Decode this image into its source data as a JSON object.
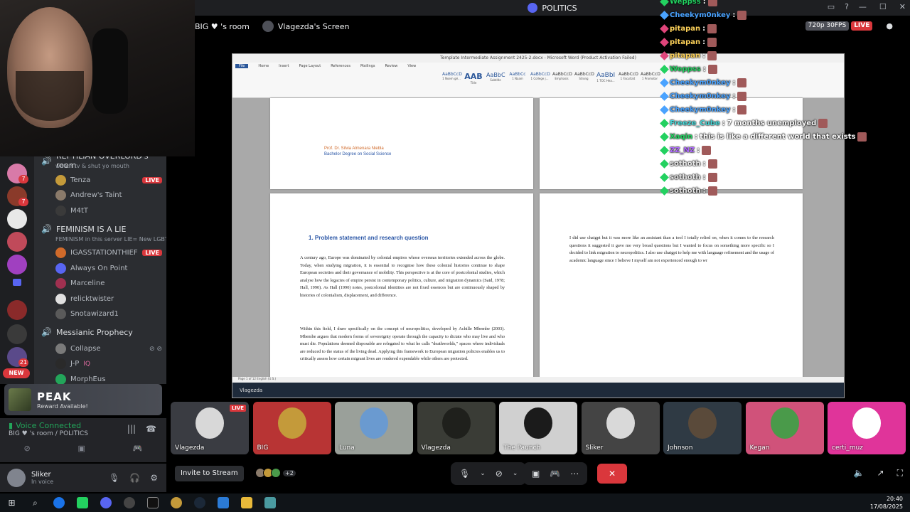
{
  "window": {
    "title": "POLITICS"
  },
  "stream_header": {
    "room": "BIG ♥ 's room",
    "screen_label": "Vlagezda's Screen",
    "quality": "720p 30FPS",
    "live": "LIVE"
  },
  "channels": [
    {
      "name": "REPTILIAN OVERLORD's room",
      "sub": "watch tv & shut yo mouth"
    },
    {
      "name": "FEMINISM IS A LIE",
      "sub": "FEMINISM in this server LIE= New LGBT..."
    },
    {
      "name": "Messianic Prophecy",
      "sub": ""
    }
  ],
  "channel_users": [
    {
      "name": "Tenza",
      "live": "LIVE",
      "color": "#c49a3a"
    },
    {
      "name": "Andrew's Taint",
      "live": "",
      "color": "#8a7a6a"
    },
    {
      "name": "M4tT",
      "live": "",
      "color": "#3a3a3a"
    },
    {
      "name": "IGASSTATIONTHIEF",
      "live": "LIVE",
      "color": "#d06a2a"
    },
    {
      "name": "Always On Point",
      "live": "",
      "color": "#5865f2"
    },
    {
      "name": "Marceline",
      "live": "",
      "color": "#a03050"
    },
    {
      "name": "relicktwister",
      "live": "",
      "color": "#e0e0e0"
    },
    {
      "name": "Snotawizard1",
      "live": "",
      "color": "#5a5a5a"
    },
    {
      "name": "Collapse",
      "live": "",
      "color": "#7a7a7a"
    },
    {
      "name": "J-P",
      "live": "",
      "extra": "IQ",
      "color": "#2a2a2a"
    },
    {
      "name": "MorphEus",
      "live": "",
      "color": "#23a55a"
    }
  ],
  "rail": {
    "mentions": [
      "7",
      "7",
      "21"
    ],
    "new_label": "NEW"
  },
  "activity": {
    "title": "PEAK",
    "subtitle": "Reward Available!"
  },
  "voice": {
    "status": "Voice Connected",
    "location": "BIG ♥ 's room / POLITICS"
  },
  "user": {
    "name": "Sliker",
    "status": "In voice"
  },
  "word": {
    "title": "Template Intermediate Assignment 2425-2.docx - Microsoft Word (Product Activation Failed)",
    "tabs": [
      "File",
      "Home",
      "Insert",
      "Page Layout",
      "References",
      "Mailings",
      "Review",
      "View"
    ],
    "style_previews": [
      "AaBbCcD",
      "AAB",
      "AaBbC",
      "AaBbCc",
      "AaBbCcD",
      "AaBbCcD",
      "AaBbCcD",
      "AaBbI",
      "AaBbCcD",
      "AaBbCcD"
    ],
    "style_labels": [
      "1 Noem gé...",
      "Title",
      "Subtitle",
      "1 Naam",
      "1 College j...",
      "Emphasis",
      "Strong",
      "1 TOC Hea...",
      "1 Facultait",
      "1 Promotor"
    ],
    "status": "Page 1 of 12    English (U.S.)",
    "taskbar_label": "Vlagezda",
    "author": "Prof. Dr. Silvia Almenara Niebla",
    "degree": "Bachelor Degree on Social Science",
    "heading": "1.   Problem statement and research question",
    "para1": "A century ago, Europe was dominated by colonial empires whose overseas territories extended across the globe. Today, when studying migration, it is essential to recognise how these colonial histories continue to shape European societies and their governance of mobility. This perspective is at the core of postcolonial studies, which analyse how the legacies of empire persist in contemporary politics, culture, and migration dynamics (Said, 1978; Hall, 1990). As Hall (1990) notes, postcolonial identities are not fixed essences but are continuously shaped by histories of colonialism, displacement, and difference.",
    "para2": "Within this field, I draw specifically on the concept of necropolitics, developed by Achille Mbembe (2003). Mbembe argues that modern forms of sovereignty operate through the capacity to dictate who may live and who must die. Populations deemed disposable are relegated to what he calls \"deathworlds,\" spaces where individuals are reduced to the status of the living dead. Applying this framework to European migration policies enables us to critically assess how certain migrant lives are rendered expendable while others are protected.",
    "para3": "I did use chatgpt but it was more like an assistant than a tool I totally relied on, when it comes to the research questions it suggested it gave me very broad questions but I wanted to focus on something more specific so I decided to link migration to necropolitics. I also use chatgpt to help me with language refinement and the usage of academic language since I believe I myself am not experienced enough to wr"
  },
  "chat": [
    {
      "name": "Weppss",
      "text": "",
      "color": "#23d160",
      "icon": "#23d160"
    },
    {
      "name": "Cheekym0nkey",
      "text": "",
      "color": "#4aa3ff",
      "icon": "#4aa3ff"
    },
    {
      "name": "pitapan",
      "text": "",
      "color": "#ffd35a",
      "icon": "#e0457b"
    },
    {
      "name": "pitapan",
      "text": "",
      "color": "#ffd35a",
      "icon": "#e0457b"
    },
    {
      "name": "pitapan",
      "text": "",
      "color": "#ffd35a",
      "icon": "#e0457b"
    },
    {
      "name": "Weppss",
      "text": "",
      "color": "#23d160",
      "icon": "#23d160"
    },
    {
      "name": "Cheekym0nkey",
      "text": "",
      "color": "#4aa3ff",
      "icon": "#4aa3ff"
    },
    {
      "name": "Cheekym0nkey",
      "text": "",
      "color": "#4aa3ff",
      "icon": "#4aa3ff"
    },
    {
      "name": "Cheekym0nkey",
      "text": "",
      "color": "#4aa3ff",
      "icon": "#4aa3ff"
    },
    {
      "name": "Freeze_Cube",
      "text": "7 months unemployed",
      "color": "#4ad9d9",
      "icon": "#23d160"
    },
    {
      "name": "Xaqin",
      "text": "this is like a different world that exists",
      "color": "#23d160",
      "icon": "#23d160"
    },
    {
      "name": "ZZ_NZ",
      "text": "",
      "color": "#b06aff",
      "icon": "#23d160"
    },
    {
      "name": "sothoth",
      "text": "",
      "color": "#e8e8e8",
      "icon": "#23d160"
    },
    {
      "name": "sothoth",
      "text": "",
      "color": "#e8e8e8",
      "icon": "#23d160"
    },
    {
      "name": "sothoth",
      "text": "",
      "color": "#e8e8e8",
      "icon": "#23d160"
    }
  ],
  "tiles": [
    {
      "name": "Vlagezda",
      "bg": "#3a3c42",
      "live": "LIVE",
      "art": "#d8d8d8"
    },
    {
      "name": "BIG",
      "bg": "#b83434",
      "live": "",
      "art": "#c49a3a"
    },
    {
      "name": "Luna",
      "bg": "#9aa09a",
      "live": "",
      "art": "#6a9ad0"
    },
    {
      "name": "Vlagezda",
      "bg": "#3a3c36",
      "live": "",
      "art": "#1f201c"
    },
    {
      "name": "The Paunch",
      "bg": "#d0d0d0",
      "live": "",
      "art": "#1b1b1b"
    },
    {
      "name": "Sliker",
      "bg": "#444",
      "live": "",
      "art": "#d9d9d9"
    },
    {
      "name": "Johnson",
      "bg": "#2f3a44",
      "live": "",
      "art": "#5a4a3a"
    },
    {
      "name": "Kegan",
      "bg": "#d0527a",
      "live": "",
      "art": "#4a9a4a"
    },
    {
      "name": "certi_muz",
      "bg": "#e0349a",
      "live": "",
      "art": "#ffffff"
    }
  ],
  "controls": {
    "invite": "Invite to Stream",
    "others": "+2"
  },
  "clock": {
    "time": "20:40",
    "date": "17/08/2025"
  }
}
